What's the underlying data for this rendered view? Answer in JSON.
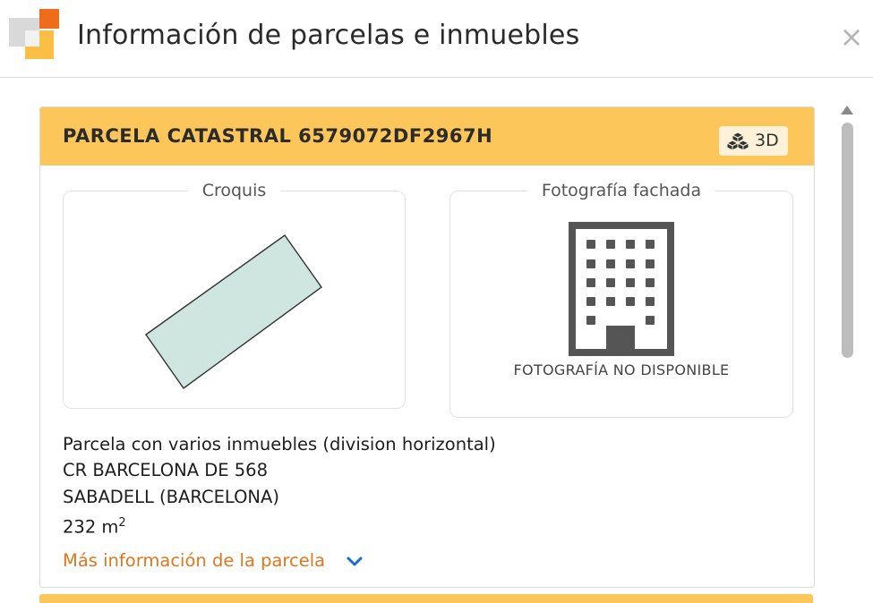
{
  "dialog": {
    "title": "Información de parcelas e inmuebles",
    "close_symbol": "×"
  },
  "parcel": {
    "header_title": "PARCELA CATASTRAL 6579072DF2967H",
    "view3d_label": "3D",
    "view3d_icon": "cubes-icon",
    "sketch_label": "Croquis",
    "facade_label": "Fotografía fachada",
    "photo_unavailable": "FOTOGRAFÍA NO DISPONIBLE",
    "facade_icon": "building-icon",
    "description": "Parcela con varios inmuebles (division horizontal)",
    "address": "CR BARCELONA DE 568",
    "municipality": "SABADELL (BARCELONA)",
    "area_value": "232 m",
    "area_superscript": "2",
    "more_info": "Más información de la parcela"
  },
  "colors": {
    "header_accent": "#fdc65b",
    "link": "#e0761d",
    "chevron": "#1a6fc9",
    "sketch_fill": "#cfe5df",
    "building_icon": "#555555"
  }
}
